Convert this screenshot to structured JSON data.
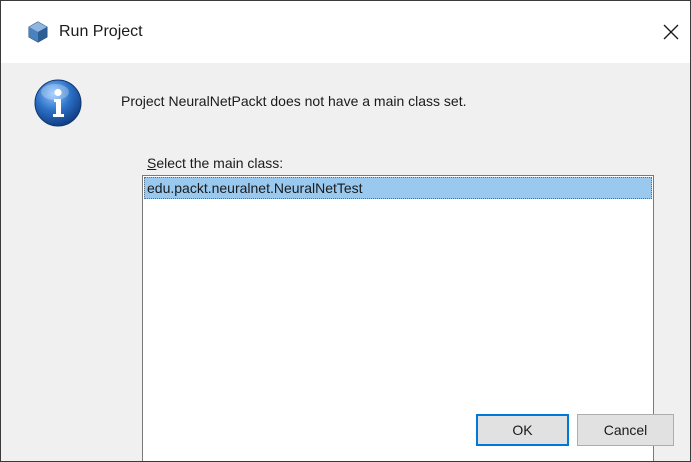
{
  "window": {
    "title": "Run Project",
    "title_icon": "netbeans-cube-icon",
    "close_glyph": "✕"
  },
  "dialog": {
    "icon": "info-icon",
    "message": "Project NeuralNetPackt does not have a main class set.",
    "list_label_mnemonic": "S",
    "list_label_rest": "elect the main class:",
    "items": [
      {
        "label": "edu.packt.neuralnet.NeuralNetTest",
        "selected": true
      }
    ]
  },
  "buttons": {
    "ok_label": "OK",
    "cancel_label": "Cancel"
  },
  "colors": {
    "selection": "#99c9ef",
    "default_button_border": "#0078d7",
    "info_icon_blue": "#2a6fc4"
  }
}
